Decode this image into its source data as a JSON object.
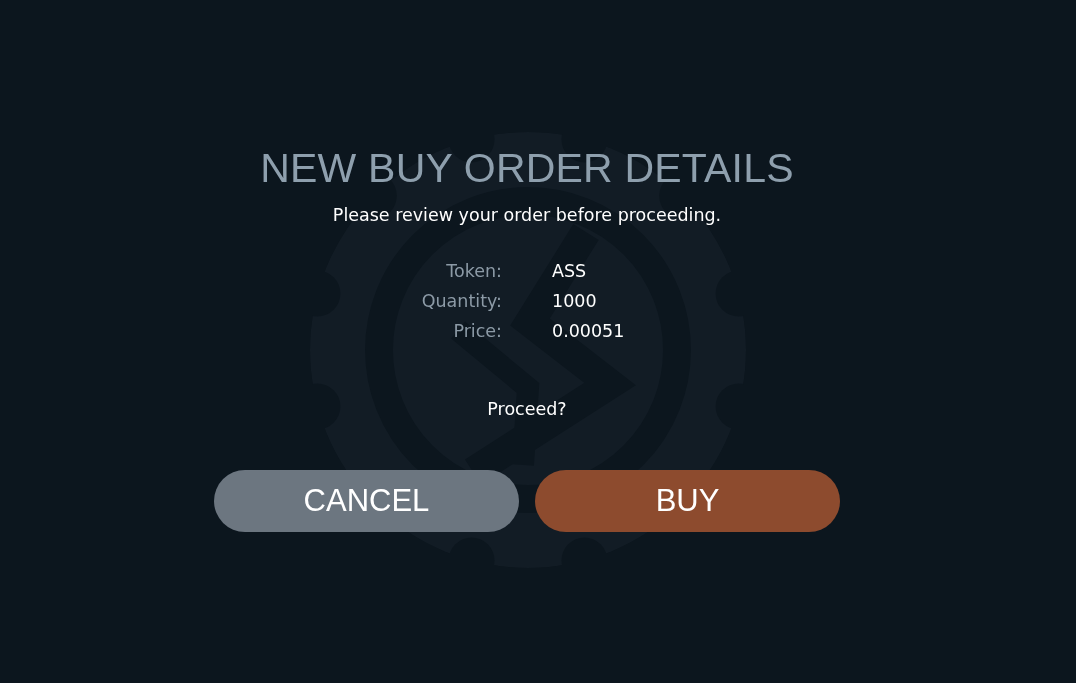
{
  "dialog": {
    "title": "NEW BUY ORDER DETAILS",
    "subtitle": "Please review your order before proceeding.",
    "details": [
      {
        "label": "Token:",
        "value": "ASS"
      },
      {
        "label": "Quantity:",
        "value": "1000"
      },
      {
        "label": "Price:",
        "value": "0.00051"
      }
    ],
    "prompt": "Proceed?",
    "buttons": [
      {
        "kind": "cancel",
        "label": "CANCEL"
      },
      {
        "kind": "confirm",
        "label": "BUY"
      }
    ]
  }
}
